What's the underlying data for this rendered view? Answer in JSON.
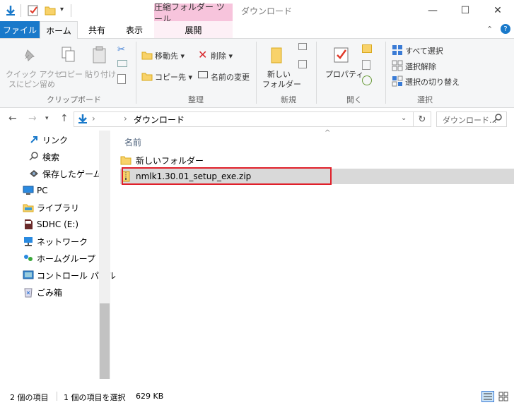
{
  "title_bar": {
    "context_tab": "圧縮フォルダー ツール",
    "window_title": "ダウンロード",
    "minimize": "—",
    "maximize": "☐",
    "close": "✕"
  },
  "tabs": {
    "file": "ファイル",
    "home": "ホーム",
    "share": "共有",
    "view": "表示",
    "manage": "展開"
  },
  "ribbon": {
    "clipboard": {
      "pin_line1": "クイック アクセ",
      "pin_line2": "スにピン留め",
      "copy": "コピー",
      "paste": "貼り付け",
      "group": "クリップボード"
    },
    "organize": {
      "move_to": "移動先",
      "copy_to": "コピー先",
      "delete": "削除",
      "rename": "名前の変更",
      "group": "整理"
    },
    "new": {
      "new_folder_line1": "新しい",
      "new_folder_line2": "フォルダー",
      "group": "新規"
    },
    "open": {
      "properties": "プロパティ",
      "group": "開く"
    },
    "select": {
      "select_all": "すべて選択",
      "select_none": "選択解除",
      "invert": "選択の切り替え",
      "group": "選択"
    }
  },
  "address": {
    "back": "←",
    "forward": "→",
    "up": "↑",
    "separator": "›",
    "path": "ダウンロード",
    "search_placeholder": "ダウンロード..."
  },
  "nav": {
    "items": [
      {
        "label": "リンク"
      },
      {
        "label": "検索"
      },
      {
        "label": "保存したゲーム"
      },
      {
        "label": "PC"
      },
      {
        "label": "ライブラリ"
      },
      {
        "label": "SDHC (E:)"
      },
      {
        "label": "ネットワーク"
      },
      {
        "label": "ホームグループ"
      },
      {
        "label": "コントロール パネル"
      },
      {
        "label": "ごみ箱"
      }
    ]
  },
  "content": {
    "column_name": "名前",
    "files": [
      {
        "name": "新しいフォルダー"
      },
      {
        "name": "nmlk1.30.01_setup_exe.zip"
      }
    ]
  },
  "status": {
    "item_count": "2 個の項目",
    "selected": "1 個の項目を選択",
    "size": "629 KB"
  },
  "colors": {
    "accent": "#1979ca",
    "highlight_border": "#e0202a",
    "context_tab": "#f7c4dc"
  }
}
